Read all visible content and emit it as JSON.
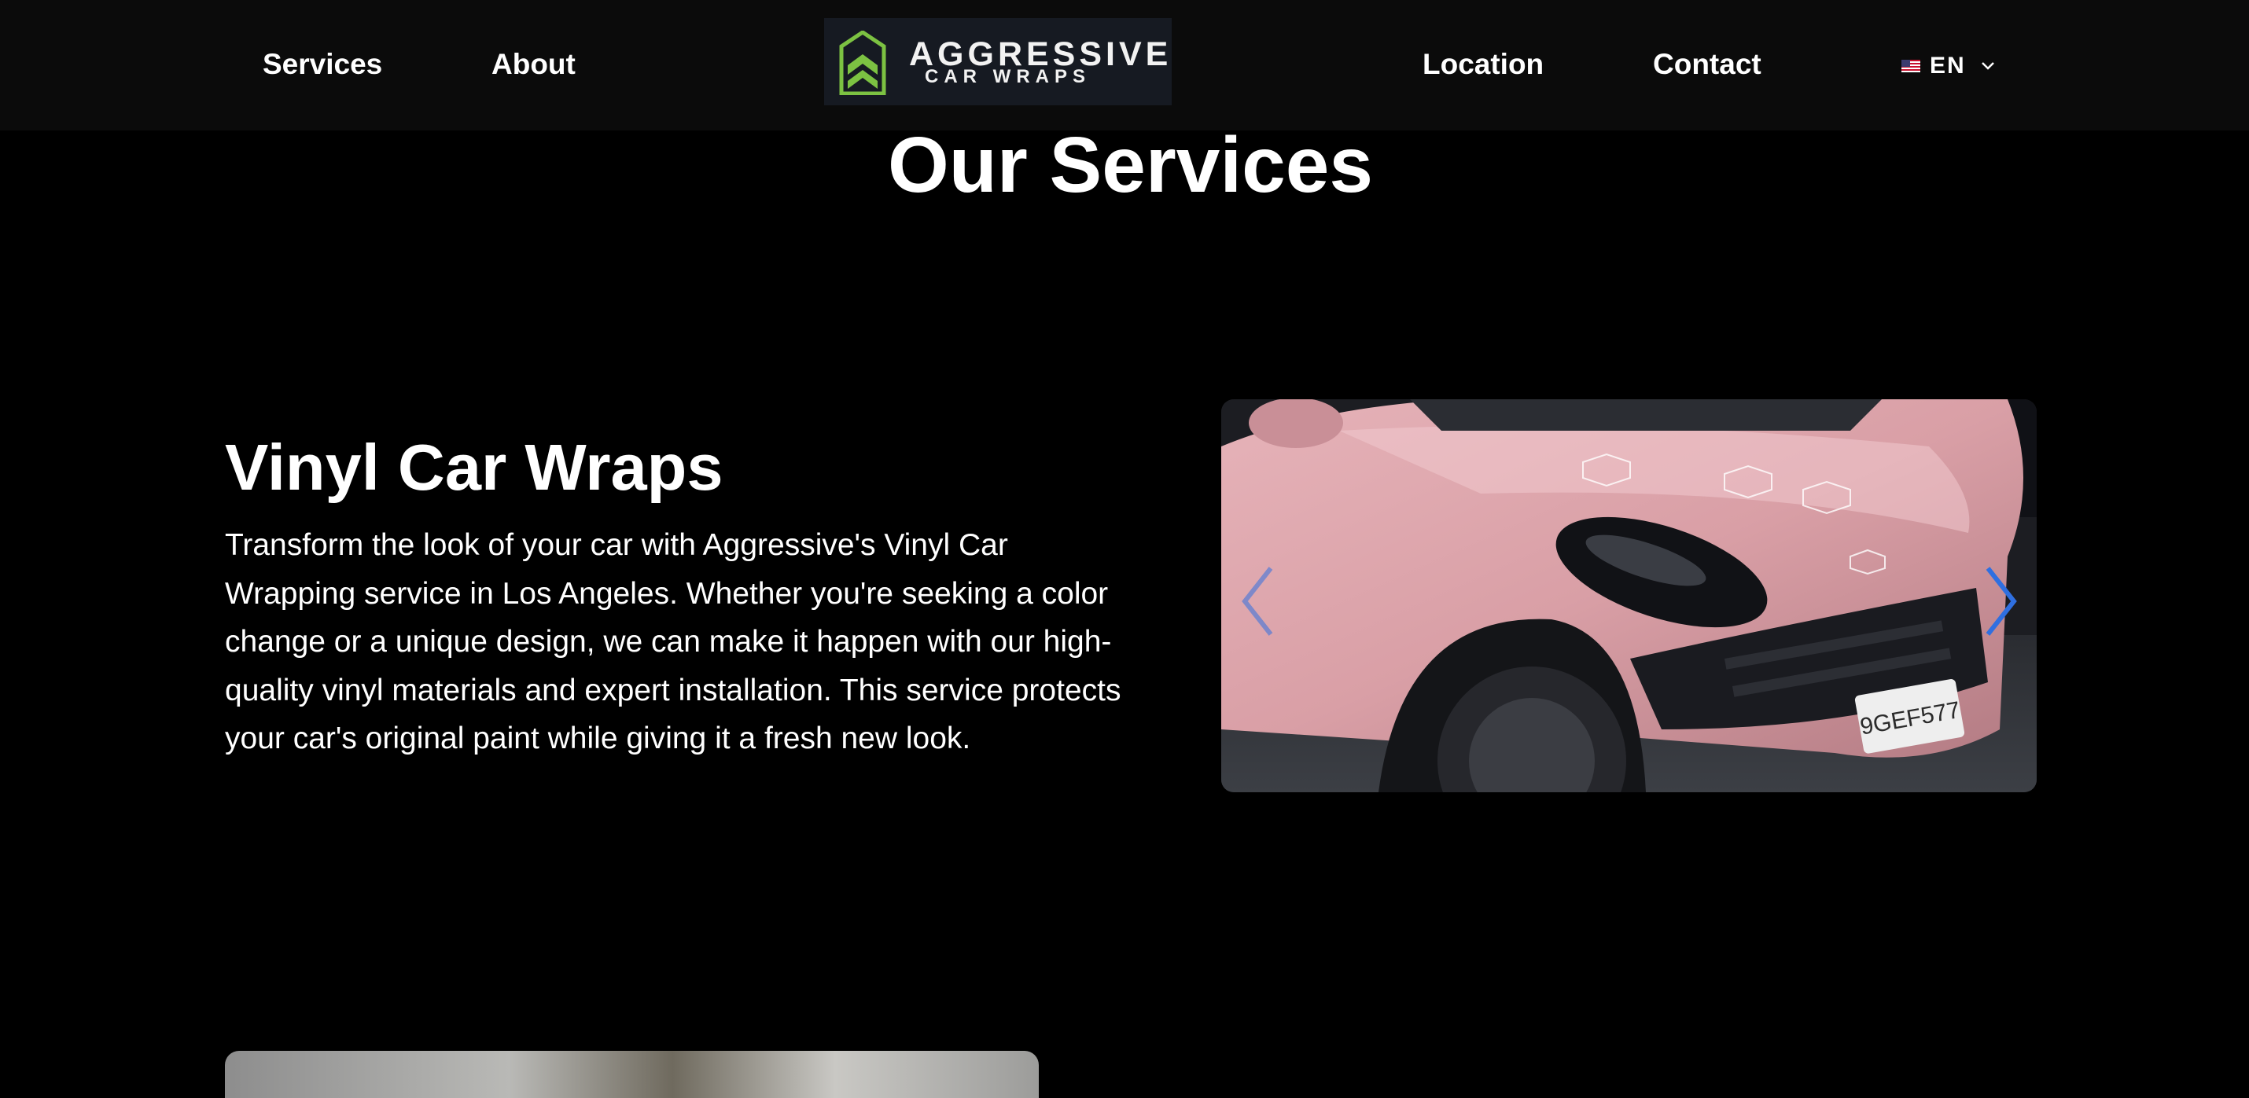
{
  "header": {
    "nav_left": [
      "Services",
      "About"
    ],
    "nav_right": [
      "Location",
      "Contact"
    ],
    "logo": {
      "word": "AGGRESSIVE",
      "sub": "CAR WRAPS",
      "mark_color": "#7cc242"
    },
    "language": {
      "code": "EN",
      "flag_icon": "us-flag-icon"
    }
  },
  "services": {
    "title": "Our Services",
    "items": [
      {
        "title": "Vinyl Car Wraps",
        "description": "Transform the look of your car with Aggressive's Vinyl Car Wrapping service in Los Angeles. Whether you're seeking a color change or a unique design, we can make it happen with our high-quality vinyl materials and expert installation. This service protects your car's original paint while giving it a fresh new look.",
        "image_subject": "pink-porsche-photo",
        "plate_text": "9GEF577"
      }
    ]
  },
  "colors": {
    "page_bg": "#000000",
    "header_bg": "#0b0b0b",
    "text": "#ffffff",
    "carousel_arrow": "#2f6fe0",
    "car_paint": "#d99fa6"
  }
}
